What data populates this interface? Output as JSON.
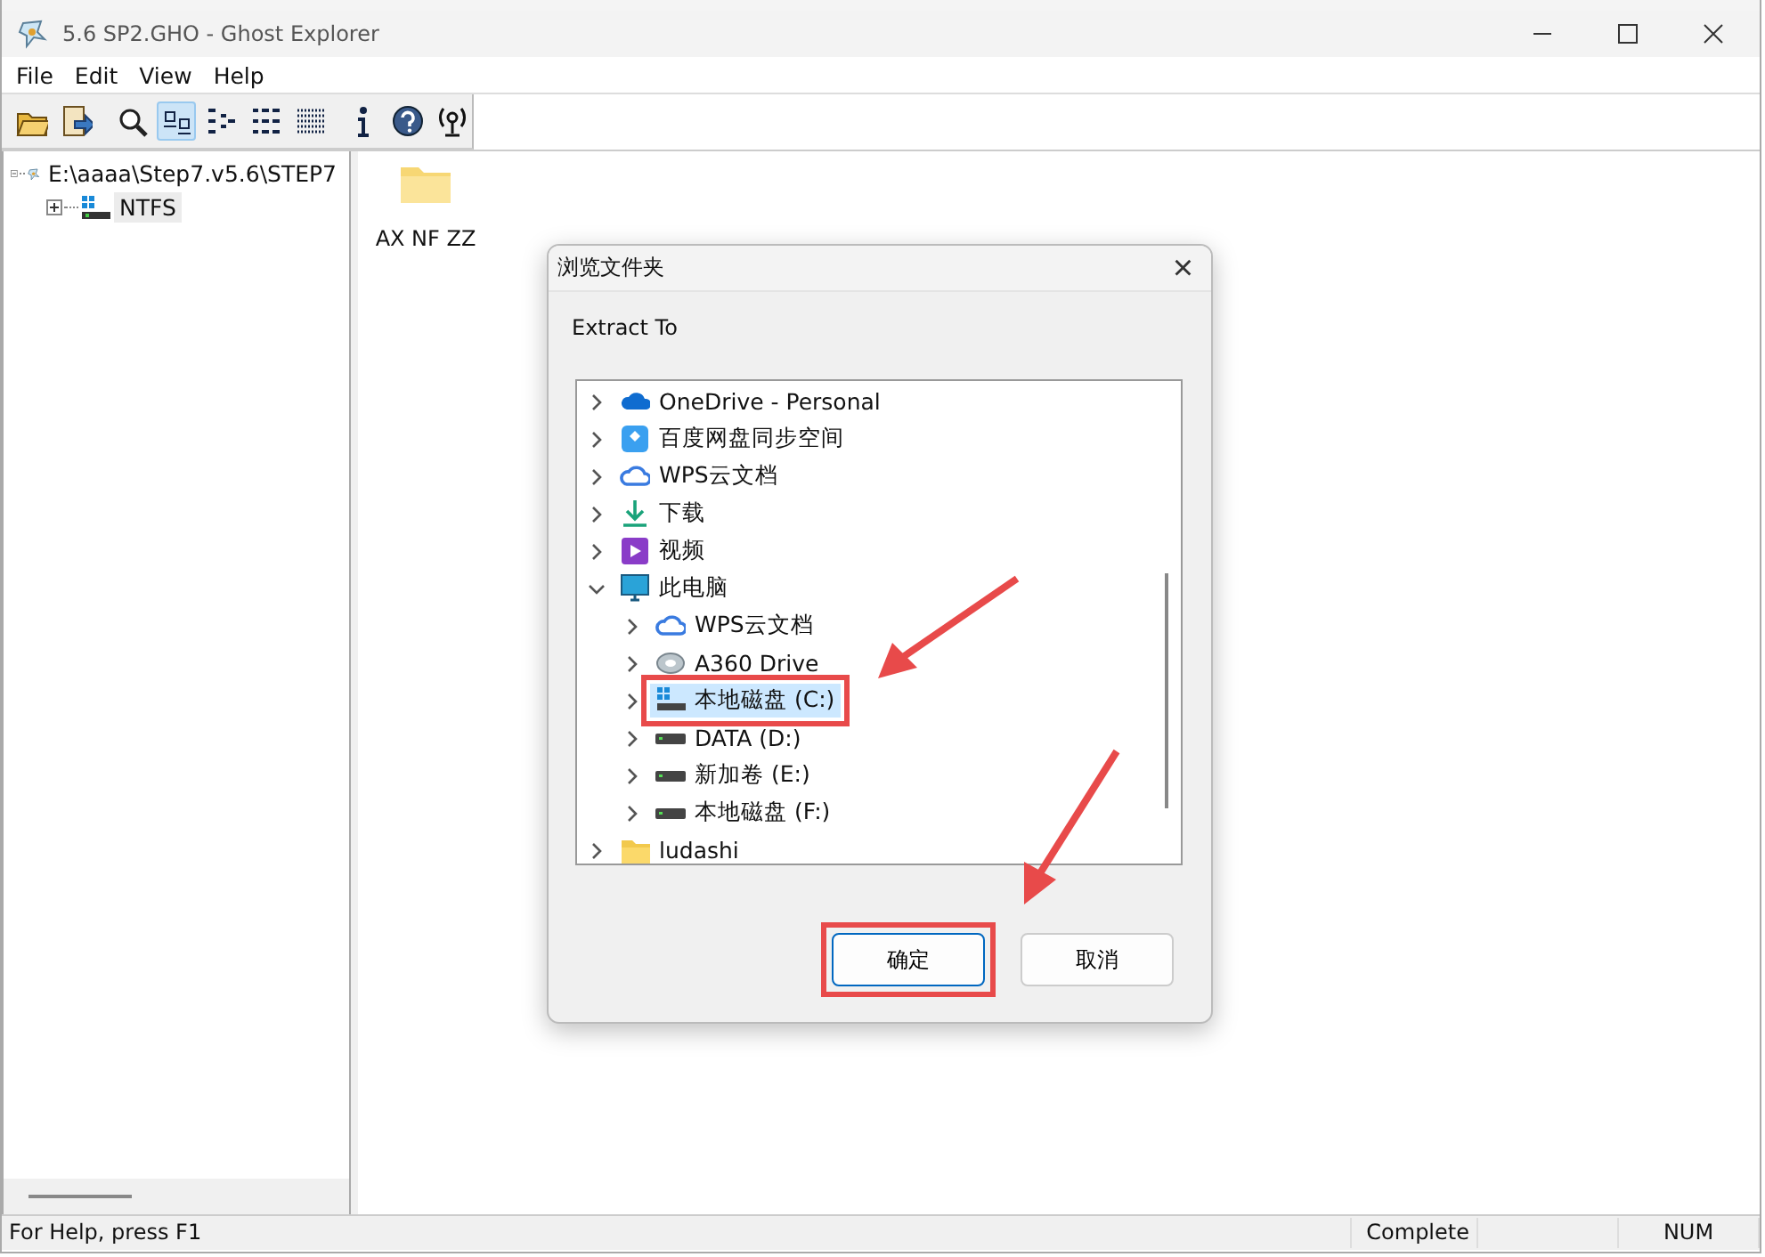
{
  "window": {
    "title": "5.6 SP2.GHO - Ghost Explorer"
  },
  "menu": [
    "File",
    "Edit",
    "View",
    "Help"
  ],
  "toolbar": [
    {
      "kind": "open",
      "selected": false
    },
    {
      "kind": "extract",
      "selected": false
    },
    {
      "kind": "sep"
    },
    {
      "kind": "search",
      "selected": false
    },
    {
      "kind": "large",
      "selected": true
    },
    {
      "kind": "small",
      "selected": false
    },
    {
      "kind": "list",
      "selected": false
    },
    {
      "kind": "details",
      "selected": false
    },
    {
      "kind": "sep"
    },
    {
      "kind": "info",
      "selected": false
    },
    {
      "kind": "help",
      "selected": false
    },
    {
      "kind": "antenna",
      "selected": false
    }
  ],
  "left_tree": [
    {
      "label": "E:\\aaaa\\Step7.v5.6\\STEP7",
      "expanded": true,
      "selected": false,
      "children": [
        {
          "label": "NTFS",
          "expanded": false,
          "selected": true
        }
      ]
    }
  ],
  "files": [
    {
      "name": "AX NF ZZ"
    }
  ],
  "dialog": {
    "title": "浏览文件夹",
    "close": "×",
    "prompt": "Extract To",
    "tree": [
      {
        "label": "OneDrive - Personal",
        "kind": "cloud",
        "expanded": false,
        "selected": false,
        "highlight": false
      },
      {
        "label": "百度网盘同步空间",
        "kind": "baidu",
        "expanded": false,
        "selected": false,
        "highlight": false
      },
      {
        "label": "WPS云文档",
        "kind": "wps",
        "expanded": false,
        "selected": false,
        "highlight": false
      },
      {
        "label": "下载",
        "kind": "download",
        "expanded": false,
        "selected": false,
        "highlight": false
      },
      {
        "label": "视频",
        "kind": "video",
        "expanded": false,
        "selected": false,
        "highlight": false
      },
      {
        "label": "此电脑",
        "kind": "pc",
        "expanded": true,
        "selected": false,
        "highlight": false,
        "children": [
          {
            "label": "WPS云文档",
            "kind": "wps",
            "expanded": false,
            "selected": false,
            "highlight": false
          },
          {
            "label": "A360 Drive",
            "kind": "a360",
            "expanded": false,
            "selected": false,
            "highlight": false
          },
          {
            "label": "本地磁盘 (C:)",
            "kind": "sysdrive",
            "expanded": false,
            "selected": true,
            "highlight": true
          },
          {
            "label": "DATA (D:)",
            "kind": "drive",
            "expanded": false,
            "selected": false,
            "highlight": false
          },
          {
            "label": "新加卷 (E:)",
            "kind": "drive",
            "expanded": false,
            "selected": false,
            "highlight": false
          },
          {
            "label": "本地磁盘 (F:)",
            "kind": "drive",
            "expanded": false,
            "selected": false,
            "highlight": false
          }
        ]
      },
      {
        "label": "ludashi",
        "kind": "folder",
        "expanded": false,
        "selected": false,
        "highlight": false
      }
    ],
    "buttons": [
      {
        "label": "确定",
        "default": true,
        "highlight": true
      },
      {
        "label": "取消",
        "default": false,
        "highlight": false
      }
    ]
  },
  "status_bar": [
    {
      "text": "For Help, press F1"
    },
    {
      "text": "Complete"
    },
    {
      "text": "NUM"
    }
  ]
}
